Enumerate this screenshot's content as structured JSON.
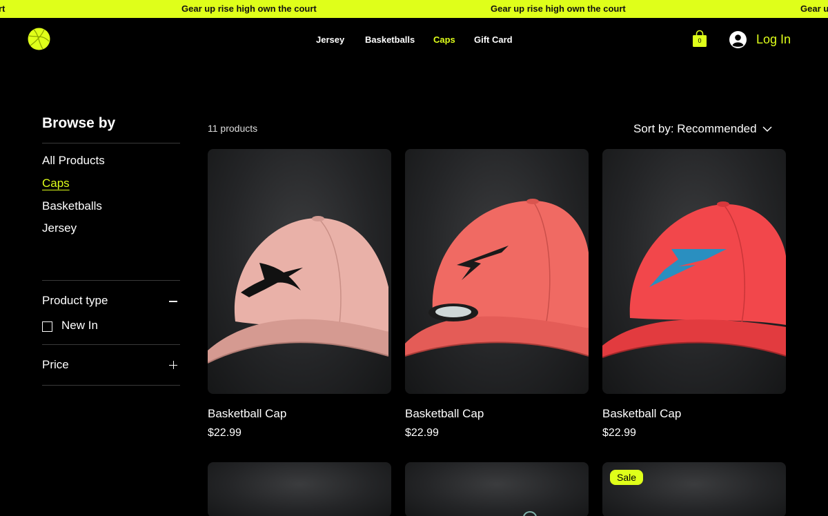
{
  "marquee": {
    "text_1": "rt",
    "text_2": "Gear up rise high own the court",
    "text_3": "Gear up rise high own the court",
    "text_4": "Gear u"
  },
  "nav": {
    "items": [
      {
        "label": "Jersey"
      },
      {
        "label": "Basketballs"
      },
      {
        "label": "Caps"
      },
      {
        "label": "Gift Card"
      }
    ],
    "active": "Caps"
  },
  "cart": {
    "count": "0"
  },
  "account": {
    "login_label": "Log In"
  },
  "sidebar": {
    "title": "Browse by",
    "categories": [
      {
        "label": "All Products"
      },
      {
        "label": "Caps"
      },
      {
        "label": "Basketballs"
      },
      {
        "label": "Jersey"
      }
    ],
    "active_category": "Caps",
    "filters": {
      "product_type": {
        "title": "Product type",
        "options": [
          {
            "label": "New In",
            "checked": false
          }
        ]
      },
      "price": {
        "title": "Price"
      }
    }
  },
  "products": {
    "count_label": "11 products",
    "sort_label": "Sort by: Recommended",
    "items": [
      {
        "name": "Basketball Cap",
        "price": "$22.99",
        "cap_color": "#e9b1a8",
        "logo_color": "#111111"
      },
      {
        "name": "Basketball Cap",
        "price": "$22.99",
        "cap_color": "#f06a63",
        "logo_color": "#1a1a1a"
      },
      {
        "name": "Basketball Cap",
        "price": "$22.99",
        "cap_color": "#f2474b",
        "logo_color": "#2a8fc0"
      }
    ],
    "second_row_badge": "Sale"
  },
  "colors": {
    "accent": "#dfff1a",
    "background": "#000000"
  }
}
